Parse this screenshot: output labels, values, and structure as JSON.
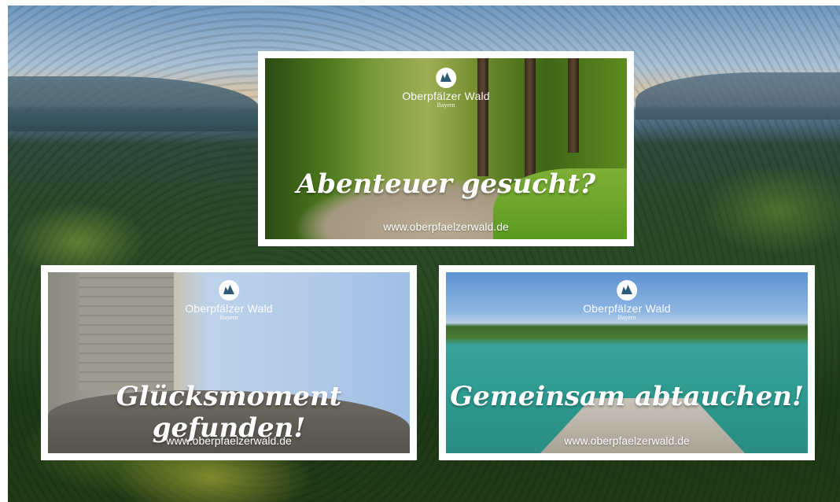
{
  "cards": [
    {
      "brand": {
        "name": "Oberpfälzer Wald",
        "region": "Bayern",
        "icon": "oberpfaelzer-wald-logo-icon"
      },
      "headline": "Abenteuer gesucht?",
      "url": "www.oberpfaelzerwald.de"
    },
    {
      "brand": {
        "name": "Oberpfälzer Wald",
        "region": "Bayern",
        "icon": "oberpfaelzer-wald-logo-icon"
      },
      "headline": "Glücksmoment gefunden!",
      "url": "www.oberpfaelzerwald.de"
    },
    {
      "brand": {
        "name": "Oberpfälzer Wald",
        "region": "Bayern",
        "icon": "oberpfaelzer-wald-logo-icon"
      },
      "headline": "Gemeinsam abtauchen!",
      "url": "www.oberpfaelzerwald.de"
    }
  ],
  "colors": {
    "background_top": "#6f98bf",
    "forest": "#2a4a22",
    "card_frame": "#ffffff",
    "text": "#ffffff"
  }
}
